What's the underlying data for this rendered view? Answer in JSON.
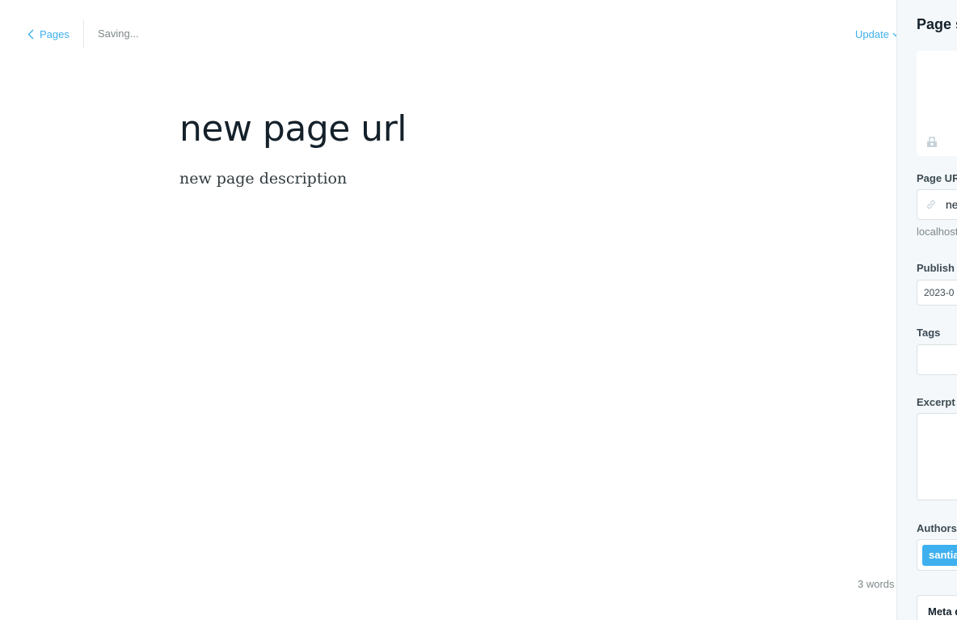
{
  "topbar": {
    "back_label": "Pages",
    "status": "Saving...",
    "update_label": "Update"
  },
  "editor": {
    "title": "new page url",
    "body": "new page description",
    "word_count": "3 words"
  },
  "settings": {
    "panel_title": "Page s",
    "page_url_label": "Page UR",
    "page_url_value": "ne",
    "page_url_hint": "localhost",
    "publish_date_label": "Publish d",
    "publish_date_value": "2023-0",
    "tags_label": "Tags",
    "excerpt_label": "Excerpt",
    "authors_label": "Authors",
    "author_name": "santia",
    "meta_label": "Meta d"
  },
  "colors": {
    "accent": "#3eb0ef",
    "panel_bg": "#f4f8fb",
    "text_dark": "#15212a",
    "text_muted": "#7d878a"
  }
}
